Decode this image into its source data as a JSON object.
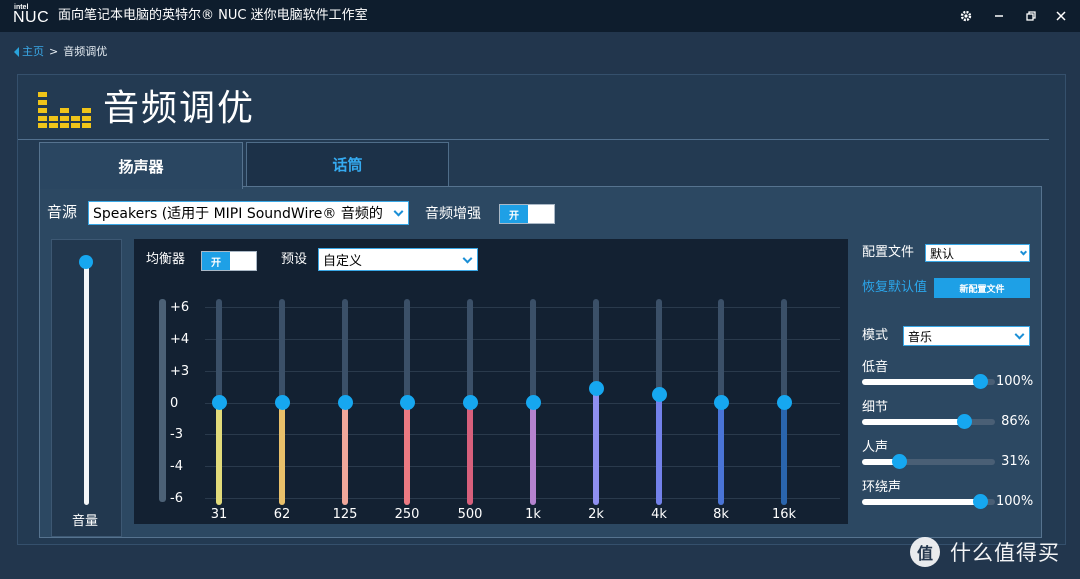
{
  "titlebar": {
    "logo_top": "intel",
    "logo_main": "NUC",
    "title": "面向笔记本电脑的英特尔® NUC 迷你电脑软件工作室"
  },
  "breadcrumb": {
    "home": "主页",
    "separator": ">",
    "current": "音频调优"
  },
  "page": {
    "title": "音频调优"
  },
  "tabs": [
    {
      "label": "扬声器",
      "active": true
    },
    {
      "label": "话筒",
      "active": false
    }
  ],
  "source": {
    "label": "音源",
    "selected": "Speakers (适用于 MIPI SoundWire® 音频的",
    "enhance_label": "音频增强",
    "enhance_toggle": "开"
  },
  "volume": {
    "label": "音量",
    "level": 1.0
  },
  "equalizer": {
    "label": "均衡器",
    "toggle": "开",
    "preset_label": "预设",
    "preset_value": "自定义",
    "db_scale": [
      "+6",
      "+4",
      "+3",
      "0",
      "-3",
      "-4",
      "-6"
    ],
    "bands": [
      {
        "freq": "31",
        "gain": 0,
        "color": "#e2db7a"
      },
      {
        "freq": "62",
        "gain": 0,
        "color": "#e9c06a"
      },
      {
        "freq": "125",
        "gain": 0,
        "color": "#f0a79a"
      },
      {
        "freq": "250",
        "gain": 0,
        "color": "#ec7a82"
      },
      {
        "freq": "500",
        "gain": 0,
        "color": "#d8607c"
      },
      {
        "freq": "1k",
        "gain": 0,
        "color": "#b583cf"
      },
      {
        "freq": "2k",
        "gain": 1.4,
        "color": "#8f8ff0"
      },
      {
        "freq": "4k",
        "gain": 0.8,
        "color": "#7381ea"
      },
      {
        "freq": "8k",
        "gain": 0,
        "color": "#4a74d6"
      },
      {
        "freq": "16k",
        "gain": 0,
        "color": "#2a65ad"
      }
    ]
  },
  "profile": {
    "label": "配置文件",
    "selected": "默认",
    "restore_label": "恢复默认值",
    "new_button": "新配置文件"
  },
  "mode": {
    "label": "模式",
    "selected": "音乐"
  },
  "sliders": [
    {
      "label": "低音",
      "value": 100,
      "display": "100%"
    },
    {
      "label": "细节",
      "value": 86,
      "display": "86%"
    },
    {
      "label": "人声",
      "value": 31,
      "display": "31%"
    },
    {
      "label": "环绕声",
      "value": 100,
      "display": "100%"
    }
  ],
  "watermark": {
    "badge": "值",
    "text": "什么值得买"
  }
}
